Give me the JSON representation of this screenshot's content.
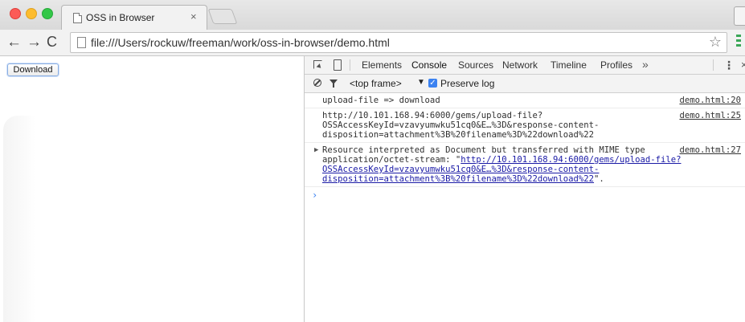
{
  "tab": {
    "title": "OSS in Browser",
    "close": "×"
  },
  "toolbar": {
    "back": "←",
    "forward": "→",
    "reload": "C",
    "url": "file:///Users/rockuw/freeman/work/oss-in-browser/demo.html",
    "star": "☆"
  },
  "page": {
    "download_label": "Download"
  },
  "devtools": {
    "tabs": [
      "Elements",
      "Console",
      "Sources",
      "Network",
      "Timeline",
      "Profiles"
    ],
    "active_tab": "Console",
    "more": "»",
    "menu": "⋮",
    "close": "×",
    "frame_select": "<top frame>",
    "frame_arrow": "▼",
    "preserve_log_label": "Preserve log",
    "preserve_log_checked": true,
    "accent_color": "#3b82f1"
  },
  "console": {
    "messages": [
      {
        "lines": [
          "upload-file => download"
        ],
        "source": "demo.html:20"
      },
      {
        "lines": [
          "http://10.101.168.94:6000/gems/upload-file?",
          "OSSAccessKeyId=vzavyumwku51cq0&E…%3D&response-content-",
          "disposition=attachment%3B%20filename%3D%22download%22"
        ],
        "source": "demo.html:25"
      },
      {
        "prefix": "Resource interpreted as Document but transferred with MIME type",
        "mime": "application/octet-stream: \"",
        "link_lines": [
          "http://10.101.168.94:6000/gems/upload-file?",
          "OSSAccessKeyId=vzavyumwku51cq0&E…%3D&response-content-",
          "disposition=attachment%3B%20filename%3D%22download%22"
        ],
        "suffix": "\".",
        "source": "demo.html:27"
      }
    ],
    "prompt": "›"
  }
}
